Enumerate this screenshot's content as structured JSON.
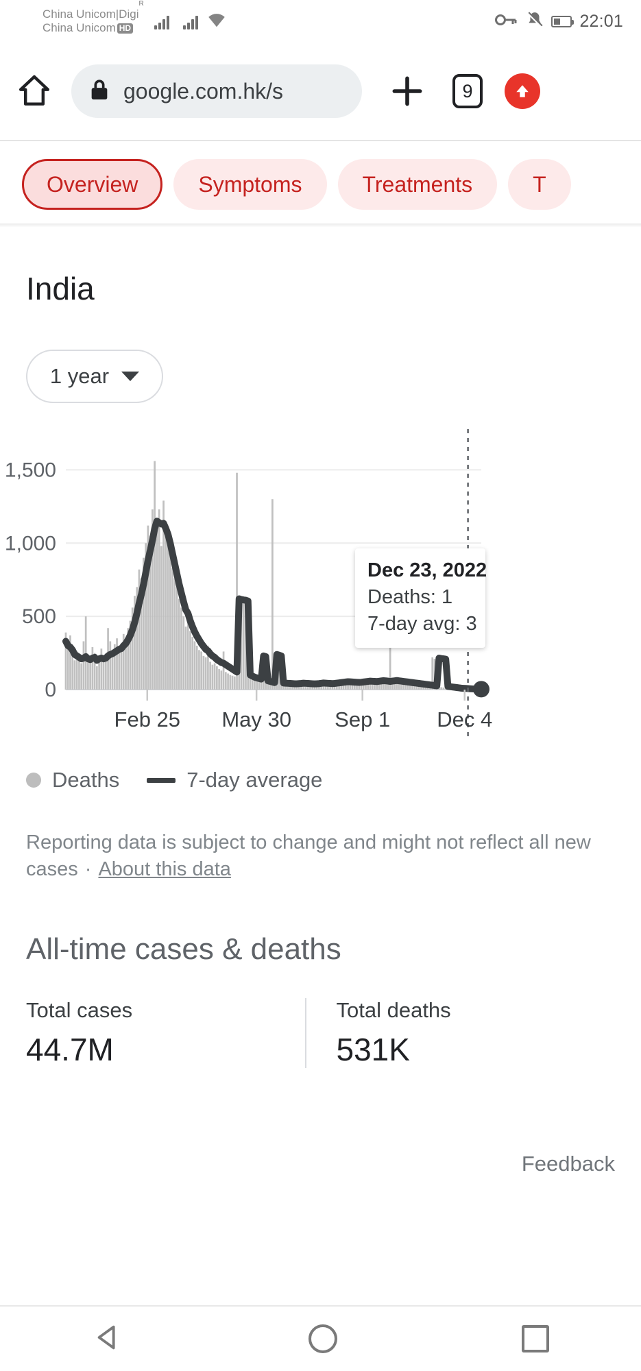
{
  "statusbar": {
    "carrier_line1": "China Unicom|Digi",
    "carrier_line2": "China Unicom",
    "hd_badge": "HD",
    "clock": "22:01",
    "icons": [
      "signal-icon",
      "signal-icon",
      "wifi-icon",
      "vpn-key-icon",
      "notifications-off-icon",
      "battery-icon"
    ]
  },
  "browser": {
    "home_icon": "home-icon",
    "lock_icon": "lock-icon",
    "url": "google.com.hk/s",
    "new_tab_icon": "plus-icon",
    "tab_count": "9",
    "update_icon": "upload-arrow-icon"
  },
  "tabs": [
    {
      "label": "Overview",
      "selected": true
    },
    {
      "label": "Symptoms",
      "selected": false
    },
    {
      "label": "Treatments",
      "selected": false
    },
    {
      "label": "T",
      "selected": false
    }
  ],
  "page": {
    "region_title": "India",
    "range_label": "1 year",
    "note_text": "Reporting data is subject to change and might not reflect all new cases",
    "note_separator": "·",
    "note_link": "About this data",
    "alltime_title": "All-time cases & deaths",
    "feedback": "Feedback"
  },
  "tooltip": {
    "date": "Dec 23, 2022",
    "deaths_row": "Deaths: 1",
    "avg_row": "7-day avg: 3"
  },
  "stats": [
    {
      "label": "Total cases",
      "value": "44.7M"
    },
    {
      "label": "Total deaths",
      "value": "531K"
    }
  ],
  "colors": {
    "accent_red": "#c5221f",
    "chip_bg": "#fdeaea",
    "chip_selected_bg": "#fbdddd",
    "bars": "#bdbdbd",
    "line": "#3c4043",
    "update_button": "#e8342a"
  },
  "navbar": {
    "back": "back-triangle-icon",
    "home": "home-circle-icon",
    "recents": "recents-square-icon"
  },
  "chart_data": {
    "type": "bar",
    "title": "India daily COVID-19 deaths",
    "xlabel": "",
    "ylabel": "",
    "ylim": [
      0,
      1750
    ],
    "yticks": [
      0,
      500,
      1000,
      1500
    ],
    "ytick_labels": [
      "0",
      "500",
      "1,000",
      "1,500"
    ],
    "xtick_labels": [
      "Feb 25",
      "May 30",
      "Sep 1",
      "Dec 4"
    ],
    "xtick_positions_pct": [
      19.6,
      45.9,
      71.4,
      96.0
    ],
    "grid": true,
    "legend_position": "below",
    "series": [
      {
        "name": "Deaths",
        "type": "bar",
        "color": "#bdbdbd",
        "values": [
          390,
          300,
          370,
          250,
          200,
          260,
          230,
          180,
          330,
          500,
          210,
          190,
          290,
          250,
          160,
          220,
          280,
          200,
          230,
          420,
          330,
          260,
          310,
          350,
          300,
          270,
          380,
          340,
          420,
          470,
          560,
          640,
          700,
          820,
          760,
          900,
          1000,
          1120,
          1050,
          1230,
          1560,
          1150,
          1230,
          980,
          1290,
          1120,
          1080,
          940,
          830,
          760,
          700,
          620,
          560,
          500,
          430,
          540,
          400,
          360,
          330,
          300,
          270,
          260,
          230,
          220,
          300,
          190,
          170,
          180,
          160,
          140,
          130,
          260,
          120,
          110,
          100,
          95,
          90,
          1480,
          640,
          620,
          610,
          600,
          90,
          80,
          85,
          70,
          75,
          60,
          65,
          240,
          55,
          60,
          50,
          1300,
          250,
          230,
          220,
          45,
          50,
          45,
          55,
          48,
          42,
          40,
          44,
          46,
          50,
          48,
          42,
          38,
          40,
          36,
          38,
          42,
          44,
          46,
          40,
          38,
          36,
          34,
          40,
          42,
          44,
          46,
          48,
          50,
          52,
          48,
          46,
          44,
          42,
          40,
          44,
          46,
          48,
          52,
          50,
          48,
          46,
          50,
          52,
          54,
          50,
          48,
          46,
          50,
          520,
          54,
          50,
          48,
          46,
          44,
          42,
          40,
          38,
          36,
          34,
          32,
          30,
          28,
          26,
          24,
          22,
          20,
          18,
          220,
          210,
          205,
          200,
          16,
          14,
          12,
          10,
          9,
          8,
          7,
          6,
          5,
          4,
          3,
          3,
          2,
          2,
          1,
          1
        ]
      },
      {
        "name": "7-day average",
        "type": "line",
        "color": "#3c4043",
        "values": [
          330,
          300,
          290,
          270,
          240,
          230,
          220,
          210,
          215,
          225,
          210,
          205,
          215,
          220,
          200,
          210,
          215,
          210,
          215,
          230,
          240,
          245,
          255,
          265,
          275,
          280,
          300,
          315,
          340,
          370,
          410,
          460,
          520,
          590,
          650,
          720,
          800,
          880,
          950,
          1020,
          1100,
          1150,
          1140,
          1130,
          1135,
          1100,
          1060,
          1000,
          930,
          860,
          790,
          720,
          660,
          600,
          545,
          520,
          470,
          430,
          395,
          365,
          340,
          315,
          295,
          275,
          265,
          245,
          230,
          220,
          205,
          195,
          185,
          180,
          170,
          160,
          150,
          140,
          130,
          120,
          620,
          615,
          612,
          610,
          605,
          100,
          92,
          85,
          80,
          76,
          72,
          230,
          225,
          60,
          56,
          52,
          48,
          240,
          235,
          230,
          45,
          44,
          43,
          42,
          41,
          40,
          40,
          41,
          42,
          44,
          43,
          42,
          41,
          40,
          39,
          40,
          41,
          43,
          45,
          44,
          43,
          42,
          41,
          42,
          44,
          46,
          48,
          50,
          52,
          54,
          53,
          52,
          51,
          50,
          49,
          50,
          52,
          54,
          56,
          58,
          57,
          56,
          55,
          57,
          59,
          61,
          60,
          58,
          56,
          58,
          60,
          62,
          60,
          58,
          56,
          54,
          52,
          50,
          48,
          46,
          44,
          42,
          40,
          38,
          36,
          34,
          32,
          30,
          28,
          26,
          215,
          212,
          210,
          208,
          22,
          20,
          18,
          16,
          14,
          12,
          10,
          9,
          8,
          7,
          6,
          5,
          4,
          4,
          3,
          3
        ]
      }
    ],
    "annotations": [
      {
        "type": "tooltip",
        "date": "Dec 23, 2022",
        "deaths": 1,
        "seven_day_avg": 3
      },
      {
        "type": "cursor-line",
        "x_pct": 96.8
      }
    ]
  }
}
